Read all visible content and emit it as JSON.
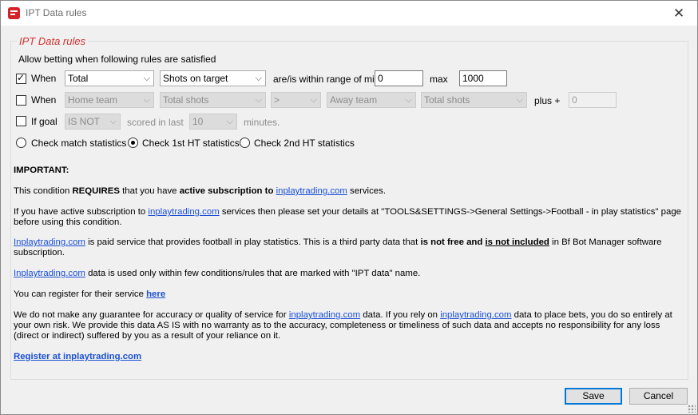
{
  "window": {
    "title": "IPT Data rules",
    "close_glyph": "✕"
  },
  "group": {
    "title": "IPT Data rules"
  },
  "intro": "Allow betting when following rules are satisfied",
  "row1": {
    "checked": true,
    "label": "When",
    "select1": "Total",
    "select2": "Shots on target",
    "range_label": "are/is within range of min",
    "min_value": "0",
    "max_label": "max",
    "max_value": "1000"
  },
  "row2": {
    "checked": false,
    "label": "When",
    "select1": "Home team",
    "select2": "Total shots",
    "select3": ">",
    "select4": "Away team",
    "select5": "Total shots",
    "plus_label": "plus +",
    "plus_value": "0"
  },
  "row3": {
    "checked": false,
    "label": "If goal",
    "select1": "IS NOT",
    "scored_label": "scored in last",
    "select2": "10",
    "minutes_label": "minutes."
  },
  "radios": {
    "opt1": "Check match statistics",
    "opt2": "Check 1st HT statistics",
    "opt3": "Check 2nd HT statistics",
    "selected": "opt2"
  },
  "info": {
    "important": "IMPORTANT:",
    "p1_a": "This condition ",
    "p1_b": "REQUIRES",
    "p1_c": " that you have ",
    "p1_d": "active subscription to",
    "p1_e": " ",
    "p1_link": "inplaytrading.com",
    "p1_f": " services.",
    "p2_a": "If you have active subscription to ",
    "p2_link": "inplaytrading.com",
    "p2_b": " services then please set your details at \"TOOLS&SETTINGS->General Settings->Football - in play statistics\" page before using this condition.",
    "p3_link": "Inplaytrading.com",
    "p3_a": " is paid service that provides football in play statistics. This is a third party data that ",
    "p3_b": "is not free and",
    "p3_c": " ",
    "p3_d": "is not included",
    "p3_e": " in Bf Bot Manager software subscription.",
    "p4_link": "Inplaytrading.com",
    "p4_a": " data is used only within few conditions/rules  that are marked with \"IPT data\" name.",
    "p5_a": "You can register for their service ",
    "p5_link": "here",
    "p6_a": "We do not make any guarantee for accuracy or quality of service for ",
    "p6_link1": "inplaytrading.com",
    "p6_b": " data. If you rely on ",
    "p6_link2": "inplaytrading.com",
    "p6_c": " data to place bets, you do so entirely at your own risk. We provide this data AS IS with no warranty as to the accuracy, completeness or timeliness of such data and accepts no responsibility for any loss (direct or indirect) suffered by you as a result of your reliance on it.",
    "register_link": "Register at inplaytrading.com"
  },
  "buttons": {
    "save": "Save",
    "cancel": "Cancel"
  },
  "colors": {
    "group_title": "#d32f2f",
    "link": "#1a4fd6",
    "default_button_border": "#0078d7"
  },
  "icons": {
    "app": "app-logo-icon",
    "close": "close-icon",
    "dropdown": "chevron-down-icon"
  }
}
